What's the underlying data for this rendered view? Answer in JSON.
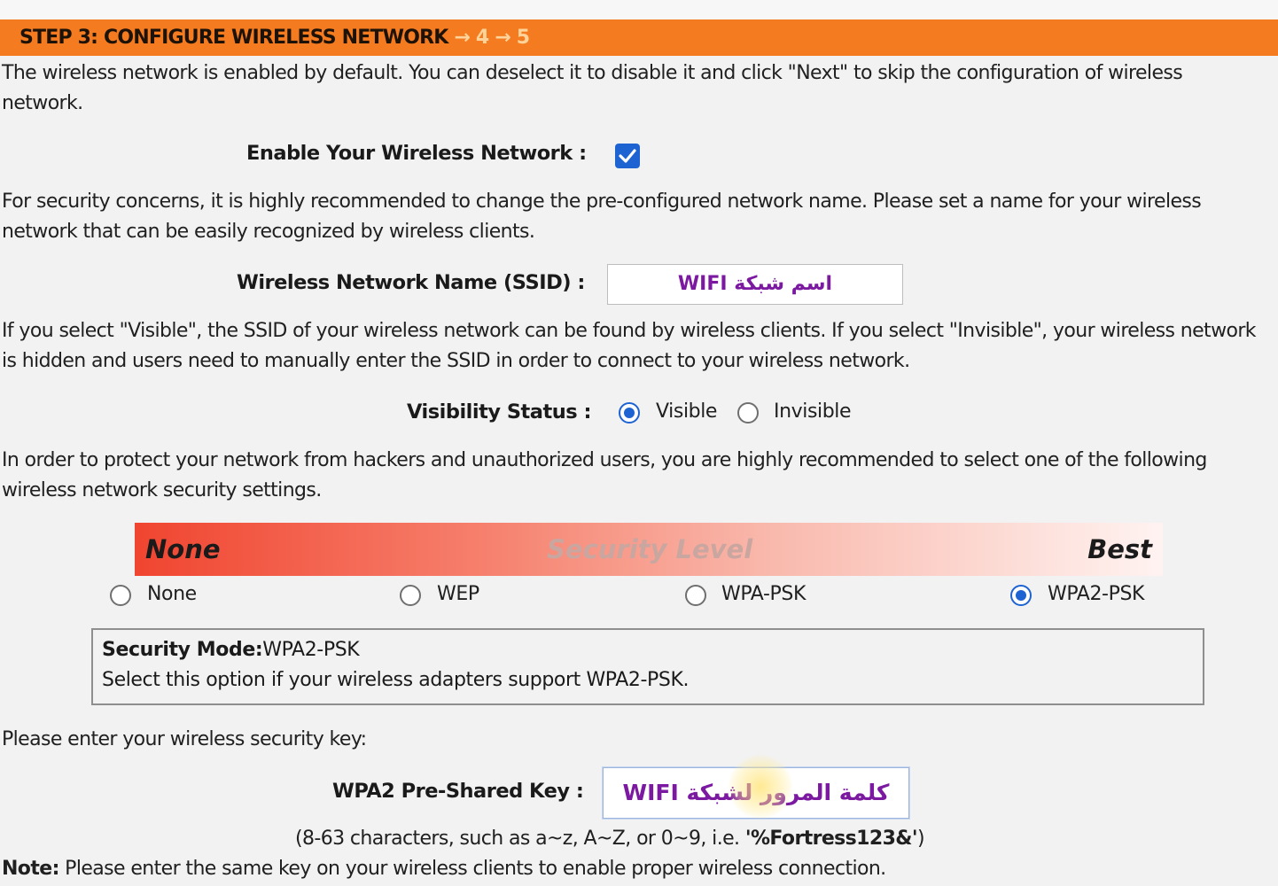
{
  "header": {
    "step_label": "STEP 3: CONFIGURE WIRELESS NETWORK",
    "rest_label": "→ 4 → 5"
  },
  "intro_text": "The wireless network is enabled by default. You can deselect it to disable it and click \"Next\" to skip the configuration of wireless network.",
  "enable": {
    "label": "Enable Your Wireless Network :",
    "checked": true
  },
  "security_note": "For security concerns, it is highly recommended to change the pre-configured network name. Please set a name for your wireless network that can be easily recognized by wireless clients.",
  "ssid": {
    "label": "Wireless Network Name (SSID) :",
    "value": "اسم شبكة WIFI"
  },
  "visibility_note": "If you select \"Visible\", the SSID of your wireless network can be found by wireless clients. If you select \"Invisible\", your wireless network is hidden and users need to manually enter the SSID in order to connect to your wireless network.",
  "visibility": {
    "label": "Visibility Status :",
    "options": [
      "Visible",
      "Invisible"
    ],
    "selected": "Visible"
  },
  "protect_note": "In order to protect your network from hackers and unauthorized users, you are highly recommended to select one of the following wireless network security settings.",
  "security_bar": {
    "left": "None",
    "center": "Security Level",
    "right": "Best"
  },
  "security_options": {
    "options": [
      "None",
      "WEP",
      "WPA-PSK",
      "WPA2-PSK"
    ],
    "selected": "WPA2-PSK"
  },
  "mode_box": {
    "title": "Security Mode:",
    "mode": "WPA2-PSK",
    "description": "Select this option if your wireless adapters support WPA2-PSK."
  },
  "key_prompt": "Please enter your wireless security key:",
  "key": {
    "label": "WPA2 Pre-Shared Key :",
    "value": "كلمة المرور لشبكة WIFI",
    "hint_prefix": "(8-63 characters, such as a~z, A~Z, or 0~9, i.e. ",
    "hint_example": "'%Fortress123&'",
    "hint_suffix": ")"
  },
  "note": {
    "title": "Note:",
    "text": " Please enter the same key on your wireless clients to enable proper wireless connection."
  },
  "colors": {
    "header": "#f47b20",
    "accent": "#1e63d2",
    "annotation": "#7b1aa0"
  }
}
